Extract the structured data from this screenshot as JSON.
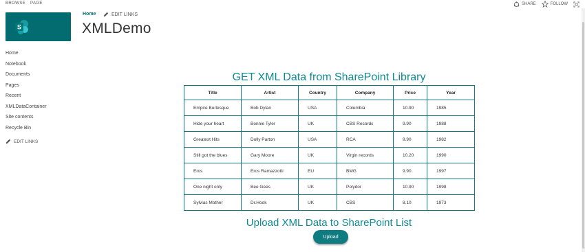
{
  "ribbon": {
    "tabs": [
      "BROWSE",
      "PAGE"
    ],
    "share_label": "SHARE",
    "follow_label": "FOLLOW"
  },
  "header": {
    "logo_letter": "S",
    "home_link": "Home",
    "edit_links": "EDIT LINKS",
    "page_title": "XMLDemo"
  },
  "left_nav": {
    "items": [
      "Home",
      "Notebook",
      "Documents",
      "Pages",
      "Recent",
      "XMLDataContainer",
      "Site contents",
      "Recycle Bin"
    ],
    "edit_links": "EDIT LINKS"
  },
  "main": {
    "get_title": "GET XML Data from SharePoint Library",
    "table": {
      "columns": [
        "Title",
        "Artist",
        "Country",
        "Company",
        "Price",
        "Year"
      ],
      "rows": [
        [
          "Empire Burlesque",
          "Bob Dylan",
          "USA",
          "Columbia",
          "10.90",
          "1985"
        ],
        [
          "Hide your heart",
          "Bonnie Tyler",
          "UK",
          "CBS Records",
          "9.90",
          "1988"
        ],
        [
          "Greatest Hits",
          "Dolly Parton",
          "USA",
          "RCA",
          "9.90",
          "1982"
        ],
        [
          "Still got the blues",
          "Gary Moore",
          "UK",
          "Virgin records",
          "10.20",
          "1990"
        ],
        [
          "Eros",
          "Eros Ramazzotti",
          "EU",
          "BMG",
          "9.90",
          "1997"
        ],
        [
          "One night only",
          "Bee Gees",
          "UK",
          "Polydor",
          "10.90",
          "1998"
        ],
        [
          "Sylvias Mother",
          "Dr.Hook",
          "UK",
          "CBS",
          "8.10",
          "1973"
        ]
      ]
    },
    "upload_title": "Upload XML Data to SharePoint List",
    "upload_button": "Upload"
  },
  "colors": {
    "accent": "#0e7c80",
    "logo_bg": "#036c70",
    "title_teal": "#0e8a91"
  }
}
